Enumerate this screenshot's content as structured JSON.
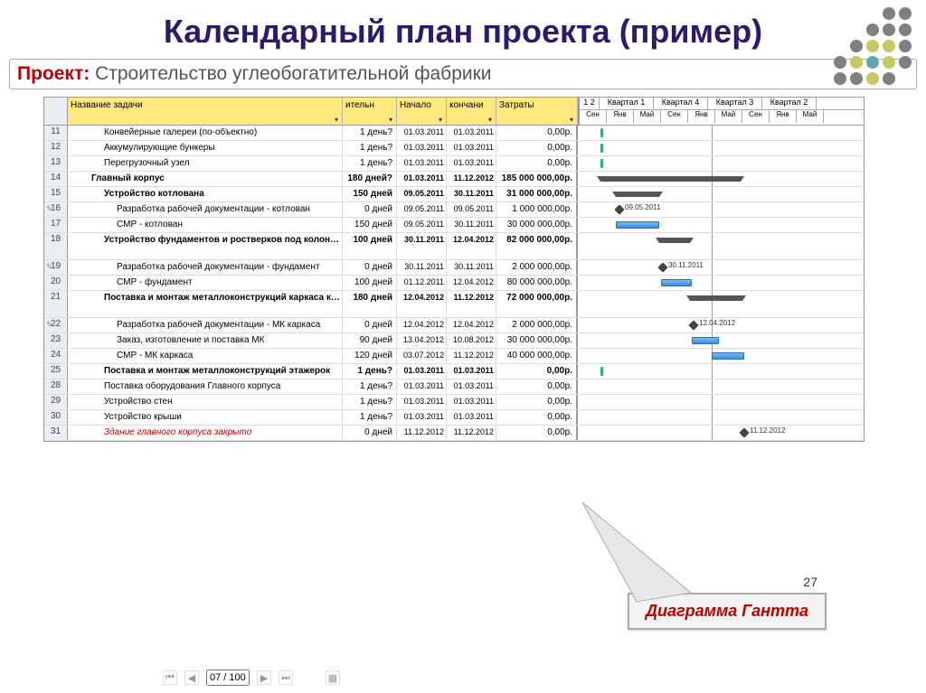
{
  "slide": {
    "title": "Календарный план проекта (пример)",
    "page_number": "27"
  },
  "project": {
    "label": "Проект:",
    "value": "Строительство углеобогатительной фабрики"
  },
  "columns": {
    "task": "Название задачи",
    "duration_short": "ительн",
    "start": "Начало",
    "end": "кончани",
    "cost": "Затраты"
  },
  "timeline": {
    "quarters": [
      "1 2",
      "Квартал 1",
      "Квартал 4",
      "Квартал 3",
      "Квартал 2"
    ],
    "months": [
      "Сен",
      "Янв",
      "Май",
      "Сен",
      "Янв",
      "Май",
      "Сен",
      "Янв",
      "Май"
    ]
  },
  "rows": [
    {
      "idx": "11",
      "task": "Конвейерные галереи (по-объектно)",
      "dur": "1 день?",
      "start": "01.03.2011",
      "end": "01.03.2011",
      "cost": "0,00р.",
      "ind": 2
    },
    {
      "idx": "12",
      "task": "Аккумулирующие бункеры",
      "dur": "1 день?",
      "start": "01.03.2011",
      "end": "01.03.2011",
      "cost": "0,00р.",
      "ind": 2
    },
    {
      "idx": "13",
      "task": "Перегрузочный узел",
      "dur": "1 день?",
      "start": "01.03.2011",
      "end": "01.03.2011",
      "cost": "0,00р.",
      "ind": 2
    },
    {
      "idx": "14",
      "task": "Главный корпус",
      "dur": "180 дней?",
      "start": "01.03.2011",
      "end": "11.12.2012",
      "cost": "185 000 000,00р.",
      "ind": 1,
      "bold": true
    },
    {
      "idx": "15",
      "task": "Устройство котлована",
      "dur": "150 дней",
      "start": "09.05.2011",
      "end": "30.11.2011",
      "cost": "31 000 000,00р.",
      "ind": 2,
      "bold": true
    },
    {
      "idx": "16",
      "task": "Разработка рабочей документации - котлован",
      "dur": "0 дней",
      "start": "09.05.2011",
      "end": "09.05.2011",
      "cost": "1 000 000,00р.",
      "ind": 3,
      "note": true
    },
    {
      "idx": "17",
      "task": "СМР - котлован",
      "dur": "150 дней",
      "start": "09.05.2011",
      "end": "30.11.2011",
      "cost": "30 000 000,00р.",
      "ind": 3
    },
    {
      "idx": "18",
      "task": "Устройство фундаментов и ростверков под колонны каркаса корпуса",
      "dur": "100 дней",
      "start": "30.11.2011",
      "end": "12.04.2012",
      "cost": "82 000 000,00р.",
      "ind": 2,
      "bold": true,
      "tall": true
    },
    {
      "idx": "19",
      "task": "Разработка рабочей документации - фундамент",
      "dur": "0 дней",
      "start": "30.11.2011",
      "end": "30.11.2011",
      "cost": "2 000 000,00р.",
      "ind": 3,
      "note": true
    },
    {
      "idx": "20",
      "task": "СМР - фундамент",
      "dur": "100 дней",
      "start": "01.12.2011",
      "end": "12.04.2012",
      "cost": "80 000 000,00р.",
      "ind": 3
    },
    {
      "idx": "21",
      "task": "Поставка и монтаж металлоконструкций каркаса корпуса",
      "dur": "180 дней",
      "start": "12.04.2012",
      "end": "11.12.2012",
      "cost": "72 000 000,00р.",
      "ind": 2,
      "bold": true,
      "tall": true
    },
    {
      "idx": "22",
      "task": "Разработка рабочей документации - МК каркаса",
      "dur": "0 дней",
      "start": "12.04.2012",
      "end": "12.04.2012",
      "cost": "2 000 000,00р.",
      "ind": 3,
      "note": true
    },
    {
      "idx": "23",
      "task": "Заказ, изготовление и поставка МК",
      "dur": "90 дней",
      "start": "13.04.2012",
      "end": "10.08.2012",
      "cost": "30 000 000,00р.",
      "ind": 3
    },
    {
      "idx": "24",
      "task": "СМР - МК каркаса",
      "dur": "120 дней",
      "start": "03.07.2012",
      "end": "11.12.2012",
      "cost": "40 000 000,00р.",
      "ind": 3
    },
    {
      "idx": "25",
      "task": "Поставка и монтаж металлоконструкций этажерок",
      "dur": "1 день?",
      "start": "01.03.2011",
      "end": "01.03.2011",
      "cost": "0,00р.",
      "ind": 2,
      "bold": true
    },
    {
      "idx": "28",
      "task": "Поставка оборудования Главного корпуса",
      "dur": "1 день?",
      "start": "01.03.2011",
      "end": "01.03.2011",
      "cost": "0,00р.",
      "ind": 2
    },
    {
      "idx": "29",
      "task": "Устройство стен",
      "dur": "1 день?",
      "start": "01.03.2011",
      "end": "01.03.2011",
      "cost": "0,00р.",
      "ind": 2
    },
    {
      "idx": "30",
      "task": "Устройство крыши",
      "dur": "1 день?",
      "start": "01.03.2011",
      "end": "01.03.2011",
      "cost": "0,00р.",
      "ind": 2
    },
    {
      "idx": "31",
      "task": "Здание главного корпуса закрыто",
      "dur": "0 дней",
      "start": "11.12.2012",
      "end": "11.12.2012",
      "cost": "0,00р.",
      "ind": 2,
      "red": true
    }
  ],
  "gantt_labels": {
    "m1": "09.05.2011",
    "m2": "30.11.2011",
    "m3": "12.04.2012",
    "m4": "11.12.2012"
  },
  "callout": "Диаграмма Гантта",
  "statusbar": {
    "page": "07 / 100"
  },
  "dots_colors": [
    [
      "",
      "",
      "",
      "#808080",
      "#808080"
    ],
    [
      "",
      "",
      "#808080",
      "#808080",
      "#808080"
    ],
    [
      "",
      "#808080",
      "#c7c763",
      "#c7c763",
      "#808080"
    ],
    [
      "#808080",
      "#c7c763",
      "#5fa8a8",
      "#c7c763",
      "#808080"
    ],
    [
      "#808080",
      "#808080",
      "#c7c763",
      "#808080",
      ""
    ]
  ]
}
